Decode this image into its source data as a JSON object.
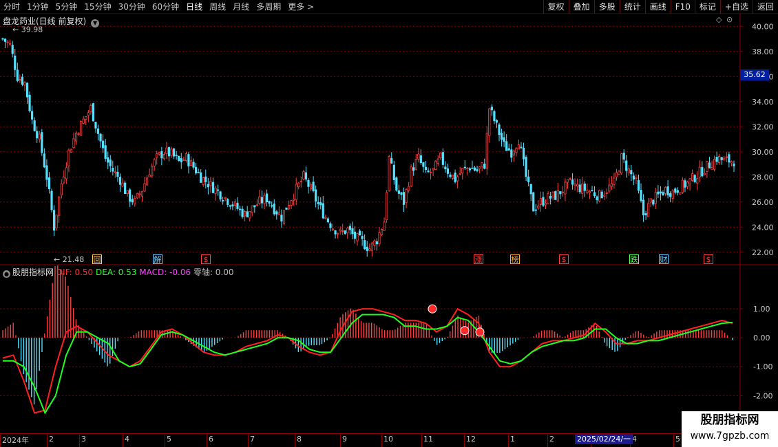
{
  "toolbar": {
    "periods": [
      "分时",
      "1分钟",
      "5分钟",
      "15分钟",
      "30分钟",
      "60分钟",
      "日线",
      "周线",
      "月线",
      "多周期",
      "更多 >"
    ],
    "active_period": "日线",
    "tools": [
      "复权",
      "叠加",
      "多股",
      "统计",
      "画线",
      "F10",
      "标记",
      "+自选",
      "返回"
    ]
  },
  "stock": {
    "title": "盘龙药业(日线 前复权)",
    "current_price_marker": "35.62",
    "high_label": "39.98",
    "low_label": "21.48"
  },
  "indicator": {
    "name": "股朋指标网",
    "dif_label": "DIF: 0.50",
    "dea_label": "DEA: 0.53",
    "macd_label": "MACD: -0.06",
    "zero_label": "零轴: 0.00"
  },
  "events": [
    {
      "label": "回",
      "color": "#ffcc66"
    },
    {
      "label": "解",
      "color": "#66ccff"
    },
    {
      "label": "$",
      "color": "#ff4040"
    },
    {
      "label": "涨",
      "color": "#ff4040"
    },
    {
      "label": "榜",
      "color": "#ffaa33"
    },
    {
      "label": "$",
      "color": "#ff4040"
    },
    {
      "label": "跌",
      "color": "#55ff55"
    },
    {
      "label": "财",
      "color": "#66ccff"
    },
    {
      "label": "$",
      "color": "#ff4040"
    }
  ],
  "date_axis": {
    "labels": [
      "2024年",
      "2",
      "3",
      "4",
      "5",
      "6",
      "7",
      "8",
      "9",
      "10",
      "11",
      "12",
      "1",
      "2",
      "3",
      "4",
      "5"
    ],
    "highlight": "2025/02/24/一"
  },
  "watermark": {
    "title": "股朋指标网",
    "url": "www.7gpzb.com"
  },
  "colors": {
    "up": "#ff4040",
    "down": "#55e0ff",
    "dif": "#ff2020",
    "dea": "#20ff20",
    "grid": "#8b0000",
    "axis_text": "#c8c8c8"
  },
  "chart_data": [
    {
      "type": "candlestick",
      "title": "盘龙药业(日线 前复权)",
      "y_ticks": [
        22.0,
        24.0,
        26.0,
        28.0,
        30.0,
        32.0,
        34.0,
        36.0,
        38.0,
        40.0
      ],
      "ylim": [
        21.0,
        41.0
      ],
      "high": 39.98,
      "low": 21.48,
      "current": 35.62,
      "close_trace": [
        {
          "x": 0,
          "y": 39.0
        },
        {
          "x": 3,
          "y": 38.5
        },
        {
          "x": 6,
          "y": 36.0
        },
        {
          "x": 9,
          "y": 35.5
        },
        {
          "x": 12,
          "y": 32.5
        },
        {
          "x": 15,
          "y": 31.0
        },
        {
          "x": 18,
          "y": 28.0
        },
        {
          "x": 21,
          "y": 24.0
        },
        {
          "x": 24,
          "y": 27.5
        },
        {
          "x": 27,
          "y": 30.0
        },
        {
          "x": 30,
          "y": 31.5
        },
        {
          "x": 33,
          "y": 32.5
        },
        {
          "x": 36,
          "y": 33.5
        },
        {
          "x": 39,
          "y": 31.5
        },
        {
          "x": 42,
          "y": 29.5
        },
        {
          "x": 45,
          "y": 28.5
        },
        {
          "x": 48,
          "y": 27.8
        },
        {
          "x": 51,
          "y": 26.5
        },
        {
          "x": 54,
          "y": 26.0
        },
        {
          "x": 57,
          "y": 27.0
        },
        {
          "x": 60,
          "y": 28.5
        },
        {
          "x": 63,
          "y": 29.5
        },
        {
          "x": 66,
          "y": 30.0
        },
        {
          "x": 69,
          "y": 29.8
        },
        {
          "x": 72,
          "y": 29.2
        },
        {
          "x": 75,
          "y": 29.5
        },
        {
          "x": 78,
          "y": 28.8
        },
        {
          "x": 81,
          "y": 28.0
        },
        {
          "x": 84,
          "y": 27.5
        },
        {
          "x": 87,
          "y": 27.0
        },
        {
          "x": 90,
          "y": 26.5
        },
        {
          "x": 93,
          "y": 26.0
        },
        {
          "x": 96,
          "y": 25.5
        },
        {
          "x": 99,
          "y": 25.0
        },
        {
          "x": 102,
          "y": 25.5
        },
        {
          "x": 105,
          "y": 26.0
        },
        {
          "x": 108,
          "y": 26.3
        },
        {
          "x": 111,
          "y": 25.5
        },
        {
          "x": 114,
          "y": 24.8
        },
        {
          "x": 117,
          "y": 26.0
        },
        {
          "x": 120,
          "y": 27.0
        },
        {
          "x": 123,
          "y": 28.0
        },
        {
          "x": 126,
          "y": 27.0
        },
        {
          "x": 129,
          "y": 25.8
        },
        {
          "x": 132,
          "y": 24.8
        },
        {
          "x": 135,
          "y": 24.0
        },
        {
          "x": 138,
          "y": 23.5
        },
        {
          "x": 141,
          "y": 23.8
        },
        {
          "x": 144,
          "y": 23.2
        },
        {
          "x": 147,
          "y": 22.8
        },
        {
          "x": 150,
          "y": 22.3
        },
        {
          "x": 153,
          "y": 23.0
        },
        {
          "x": 156,
          "y": 24.5
        },
        {
          "x": 158,
          "y": 29.5
        },
        {
          "x": 161,
          "y": 27.0
        },
        {
          "x": 164,
          "y": 26.0
        },
        {
          "x": 167,
          "y": 28.5
        },
        {
          "x": 170,
          "y": 29.5
        },
        {
          "x": 173,
          "y": 28.2
        },
        {
          "x": 176,
          "y": 28.5
        },
        {
          "x": 179,
          "y": 29.5
        },
        {
          "x": 182,
          "y": 28.5
        },
        {
          "x": 185,
          "y": 27.8
        },
        {
          "x": 188,
          "y": 28.5
        },
        {
          "x": 191,
          "y": 28.8
        },
        {
          "x": 194,
          "y": 28.5
        },
        {
          "x": 197,
          "y": 29.0
        },
        {
          "x": 199,
          "y": 33.5
        },
        {
          "x": 202,
          "y": 32.0
        },
        {
          "x": 205,
          "y": 30.5
        },
        {
          "x": 208,
          "y": 30.0
        },
        {
          "x": 211,
          "y": 31.0
        },
        {
          "x": 214,
          "y": 28.0
        },
        {
          "x": 217,
          "y": 25.5
        },
        {
          "x": 220,
          "y": 26.0
        },
        {
          "x": 223,
          "y": 26.3
        },
        {
          "x": 226,
          "y": 26.5
        },
        {
          "x": 229,
          "y": 27.0
        },
        {
          "x": 232,
          "y": 27.5
        },
        {
          "x": 235,
          "y": 27.2
        },
        {
          "x": 238,
          "y": 27.0
        },
        {
          "x": 241,
          "y": 26.8
        },
        {
          "x": 244,
          "y": 26.5
        },
        {
          "x": 247,
          "y": 27.0
        },
        {
          "x": 250,
          "y": 27.5
        },
        {
          "x": 253,
          "y": 29.5
        },
        {
          "x": 256,
          "y": 28.5
        },
        {
          "x": 259,
          "y": 27.5
        },
        {
          "x": 262,
          "y": 25.0
        },
        {
          "x": 265,
          "y": 26.0
        },
        {
          "x": 268,
          "y": 26.5
        },
        {
          "x": 271,
          "y": 27.0
        },
        {
          "x": 274,
          "y": 26.8
        },
        {
          "x": 277,
          "y": 27.2
        },
        {
          "x": 280,
          "y": 27.5
        },
        {
          "x": 283,
          "y": 28.0
        },
        {
          "x": 286,
          "y": 28.5
        },
        {
          "x": 289,
          "y": 29.0
        },
        {
          "x": 292,
          "y": 29.5
        },
        {
          "x": 295,
          "y": 29.3
        }
      ]
    },
    {
      "type": "line",
      "title": "股朋指标网",
      "y_ticks": [
        1.0,
        0.0,
        -1.0,
        -2.0
      ],
      "ylim": [
        -3.3,
        2.0
      ],
      "series": [
        {
          "name": "DIF",
          "color": "#ff2020",
          "values": [
            -0.7,
            -0.6,
            -1.5,
            -2.6,
            -2.5,
            -1.0,
            0.2,
            0.4,
            0.2,
            -0.2,
            -0.6,
            -0.8,
            -1.0,
            -0.8,
            -0.3,
            0.2,
            0.3,
            0.1,
            -0.2,
            -0.5,
            -0.6,
            -0.6,
            -0.5,
            -0.3,
            -0.2,
            -0.1,
            0.1,
            0.0,
            -0.3,
            -0.5,
            -0.6,
            -0.5,
            0.3,
            0.9,
            1.0,
            1.0,
            0.9,
            0.8,
            0.6,
            0.6,
            0.5,
            0.2,
            0.4,
            1.0,
            0.8,
            0.5,
            -0.5,
            -1.0,
            -1.0,
            -0.8,
            -0.5,
            -0.2,
            -0.1,
            -0.1,
            0.0,
            0.1,
            0.5,
            0.2,
            -0.2,
            -0.2,
            -0.1,
            -0.1,
            0.0,
            0.1,
            0.2,
            0.3,
            0.4,
            0.5,
            0.6,
            0.5
          ]
        },
        {
          "name": "DEA",
          "color": "#20ff20",
          "values": [
            -0.8,
            -0.8,
            -1.0,
            -1.7,
            -2.6,
            -2.0,
            -0.6,
            0.2,
            0.2,
            0.0,
            -0.2,
            -0.8,
            -1.0,
            -0.9,
            -0.4,
            0.1,
            0.2,
            0.1,
            -0.1,
            -0.3,
            -0.5,
            -0.6,
            -0.5,
            -0.4,
            -0.3,
            -0.2,
            0.0,
            0.0,
            -0.1,
            -0.4,
            -0.5,
            -0.5,
            0.0,
            0.5,
            0.8,
            0.8,
            0.8,
            0.7,
            0.4,
            0.4,
            0.3,
            0.3,
            0.4,
            0.7,
            0.6,
            0.2,
            -0.3,
            -0.8,
            -0.9,
            -0.8,
            -0.5,
            -0.3,
            -0.2,
            -0.1,
            -0.1,
            0.0,
            0.3,
            0.3,
            0.0,
            -0.2,
            -0.2,
            -0.1,
            -0.1,
            0.0,
            0.1,
            0.2,
            0.3,
            0.4,
            0.5,
            0.53
          ]
        }
      ]
    }
  ]
}
